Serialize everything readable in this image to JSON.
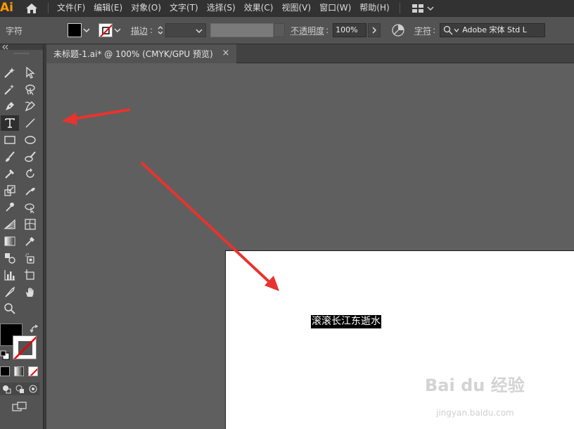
{
  "app": {
    "logo": "Ai"
  },
  "menu": [
    "文件(F)",
    "编辑(E)",
    "对象(O)",
    "文字(T)",
    "选择(S)",
    "效果(C)",
    "视图(V)",
    "窗口(W)",
    "帮助(H)"
  ],
  "control": {
    "panel_label": "字符",
    "stroke_label": "描边",
    "opacity_label": "不透明度",
    "opacity_value": "100%",
    "char_label": "字符",
    "font_value": "Adobe 宋体 Std L"
  },
  "document": {
    "tab_title": "未标题-1.ai* @ 100% (CMYK/GPU 预览)",
    "close_glyph": "×",
    "selected_text": "滚滚长江东逝水"
  },
  "watermark": {
    "brand": "Bai du 经验",
    "url": "jingyan.baidu.com"
  },
  "colors": {
    "accent_orange": "#ff9a00",
    "arrow_red": "#e8332e",
    "canvas_bg": "#5f5f5f",
    "ui_bg": "#535353"
  },
  "icons": {
    "home": "home-icon",
    "workspace": "workspace-grid-icon",
    "active_tool": "type-tool-icon"
  }
}
